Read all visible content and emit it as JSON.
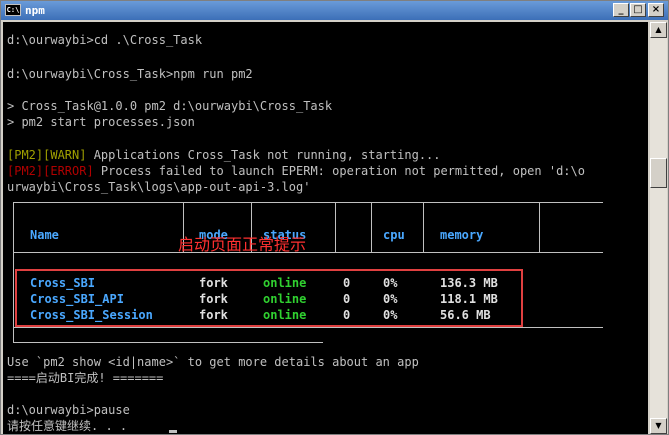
{
  "window": {
    "title": "npm",
    "icon_label": "C:\\",
    "controls": {
      "minimize": "_",
      "maximize": "□",
      "close": "×"
    }
  },
  "console": {
    "lines": [
      "d:\\ourwaybi>cd .\\Cross_Task",
      "d:\\ourwaybi\\Cross_Task>npm run pm2",
      "> Cross_Task@1.0.0 pm2 d:\\ourwaybi\\Cross_Task",
      "> pm2 start processes.json"
    ],
    "warn_prefix": "[PM2][WARN]",
    "warn_text": " Applications Cross_Task not running, starting...",
    "error_prefix": "[PM2][ERROR]",
    "error_text": " Process failed to launch EPERM: operation not permitted, open 'd:\\o",
    "error_cont": "urwaybi\\Cross_Task\\logs\\app-out-api-3.log'",
    "hint": "Use `pm2 show <id|name>` to get more details about an app",
    "done": "====启动BI完成! =======",
    "prompt_pause": "d:\\ourwaybi>pause",
    "press_key": "请按任意键继续. . ."
  },
  "table": {
    "headers": {
      "name": "Name",
      "mode": "mode",
      "status": "status",
      "cpu": "cpu",
      "memory": "memory"
    },
    "rows": [
      {
        "name": "Cross_SBI",
        "mode": "fork",
        "status": "online",
        "restart": "0",
        "cpu": "0%",
        "memory": "136.3 MB"
      },
      {
        "name": "Cross_SBI_API",
        "mode": "fork",
        "status": "online",
        "restart": "0",
        "cpu": "0%",
        "memory": "118.1 MB"
      },
      {
        "name": "Cross_SBI_Session",
        "mode": "fork",
        "status": "online",
        "restart": "0",
        "cpu": "0%",
        "memory": "56.6 MB"
      }
    ]
  },
  "annotation": "启动页面正常提示",
  "colors": {
    "header": "#4aa8ff",
    "online": "#30d030",
    "warn": "#a0a000",
    "error": "#b00000",
    "highlight": "#e04040"
  }
}
